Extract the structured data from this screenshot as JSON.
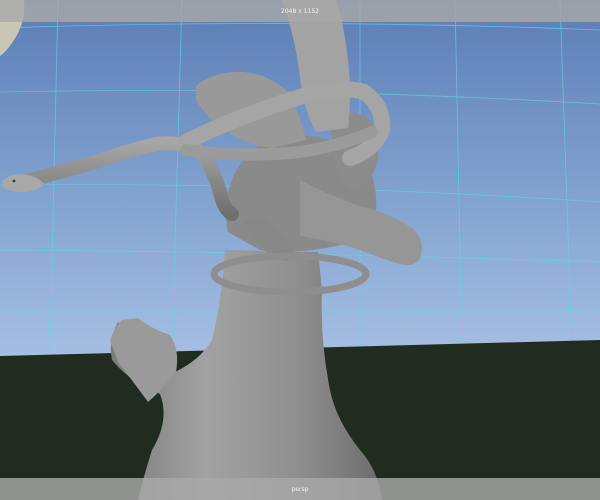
{
  "viewport": {
    "resolution_label": "2048 x 1152",
    "camera_label": "persp",
    "colors": {
      "sky_top": "#5e80b6",
      "sky_bottom": "#9db9de",
      "ground": "#1f2c1f",
      "grid_line": "#5fd6e6",
      "model_gray": "#8d8d8d",
      "gate_overlay": "#a8a8a8"
    }
  }
}
